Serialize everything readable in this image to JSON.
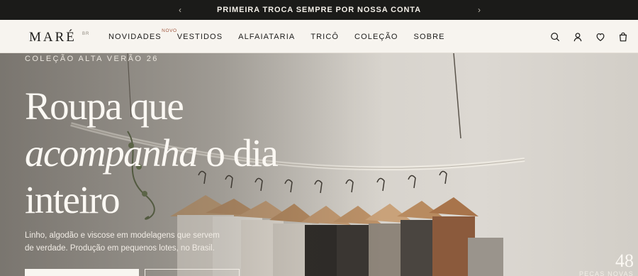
{
  "announcement": {
    "message": "PRIMEIRA TROCA SEMPRE POR NOSSA CONTA",
    "prev_icon": "chevron-left-icon",
    "next_icon": "chevron-right-icon"
  },
  "header": {
    "logo": "MARÉ",
    "logo_suffix": "BR",
    "nav": [
      {
        "label": "NOVIDADES",
        "badge": "NOVO"
      },
      {
        "label": "VESTIDOS"
      },
      {
        "label": "ALFAIATARIA"
      },
      {
        "label": "TRICÔ"
      },
      {
        "label": "COLEÇÃO"
      },
      {
        "label": "SOBRE"
      }
    ],
    "icons": [
      "search-icon",
      "account-icon",
      "wishlist-icon",
      "bag-icon"
    ]
  },
  "hero": {
    "eyebrow": "COLEÇÃO ALTA VERÃO 26",
    "headline": {
      "line1": "Roupa que",
      "line2_italic": "acompanha",
      "line2_rest": " o dia",
      "line3": "inteiro"
    },
    "subtext": "Linho, algodão e viscose em modelagens que servem de verdade. Produção em pequenos lotes, no Brasil.",
    "stat_value": "48",
    "stat_label": "PEÇAS NOVAS"
  },
  "colors": {
    "announcement_bg": "#1b1b19",
    "header_bg": "#f7f4ef",
    "badge": "#a0553b",
    "hero_text": "#fbf8f3"
  }
}
